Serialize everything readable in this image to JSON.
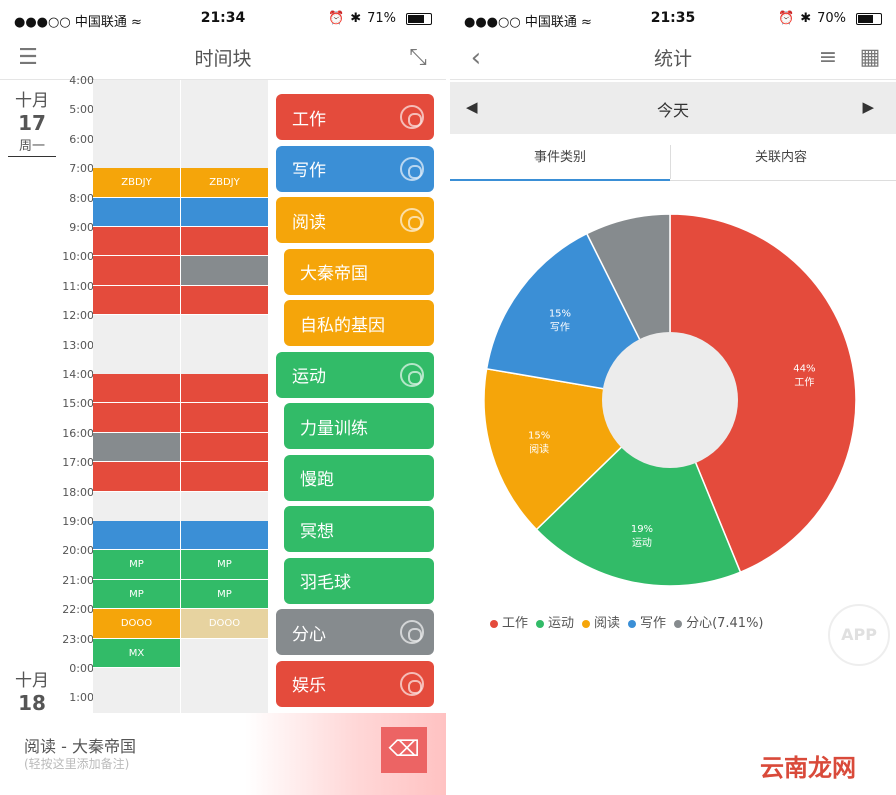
{
  "left": {
    "status": {
      "carrier": "●●●○○ 中国联通 ≈",
      "time": "21:34",
      "battery": "71%",
      "battery_pct": 71
    },
    "title": "时间块",
    "dates": [
      {
        "month": "十月",
        "day": "17",
        "weekday": "周一"
      },
      {
        "month": "十月",
        "day": "18"
      }
    ],
    "hours": [
      "4:00",
      "5:00",
      "6:00",
      "7:00",
      "8:00",
      "9:00",
      "10:00",
      "11:00",
      "12:00",
      "13:00",
      "14:00",
      "15:00",
      "16:00",
      "17:00",
      "18:00",
      "19:00",
      "20:00",
      "21:00",
      "22:00",
      "23:00",
      "0:00",
      "1:00"
    ],
    "blocks": [
      {
        "col": 0,
        "start": 7,
        "end": 8,
        "color": "#f5a50a",
        "label": "ZBDJY"
      },
      {
        "col": 1,
        "start": 7,
        "end": 8,
        "color": "#f5a50a",
        "label": "ZBDJY"
      },
      {
        "col": 0,
        "start": 8,
        "end": 9,
        "color": "#3b8fd6",
        "label": ""
      },
      {
        "col": 1,
        "start": 8,
        "end": 9,
        "color": "#3b8fd6",
        "label": ""
      },
      {
        "col": 0,
        "start": 9,
        "end": 10,
        "color": "#e44b3c",
        "label": ""
      },
      {
        "col": 1,
        "start": 9,
        "end": 10,
        "color": "#e44b3c",
        "label": ""
      },
      {
        "col": 0,
        "start": 10,
        "end": 11,
        "color": "#e44b3c",
        "label": ""
      },
      {
        "col": 1,
        "start": 10,
        "end": 11,
        "color": "#868b8e",
        "label": ""
      },
      {
        "col": 0,
        "start": 11,
        "end": 12,
        "color": "#e44b3c",
        "label": ""
      },
      {
        "col": 1,
        "start": 11,
        "end": 12,
        "color": "#e44b3c",
        "label": ""
      },
      {
        "col": 0,
        "start": 14,
        "end": 15,
        "color": "#e44b3c",
        "label": ""
      },
      {
        "col": 1,
        "start": 14,
        "end": 15,
        "color": "#e44b3c",
        "label": ""
      },
      {
        "col": 0,
        "start": 15,
        "end": 16,
        "color": "#e44b3c",
        "label": ""
      },
      {
        "col": 1,
        "start": 15,
        "end": 16,
        "color": "#e44b3c",
        "label": ""
      },
      {
        "col": 0,
        "start": 16,
        "end": 17,
        "color": "#868b8e",
        "label": ""
      },
      {
        "col": 1,
        "start": 16,
        "end": 17,
        "color": "#e44b3c",
        "label": ""
      },
      {
        "col": 0,
        "start": 17,
        "end": 18,
        "color": "#e44b3c",
        "label": ""
      },
      {
        "col": 1,
        "start": 17,
        "end": 18,
        "color": "#e44b3c",
        "label": ""
      },
      {
        "col": 0,
        "start": 19,
        "end": 20,
        "color": "#3b8fd6",
        "label": ""
      },
      {
        "col": 1,
        "start": 19,
        "end": 20,
        "color": "#3b8fd6",
        "label": ""
      },
      {
        "col": 0,
        "start": 20,
        "end": 21,
        "color": "#32bb68",
        "label": "MP"
      },
      {
        "col": 1,
        "start": 20,
        "end": 21,
        "color": "#32bb68",
        "label": "MP"
      },
      {
        "col": 0,
        "start": 21,
        "end": 22,
        "color": "#32bb68",
        "label": "MP"
      },
      {
        "col": 1,
        "start": 21,
        "end": 22,
        "color": "#32bb68",
        "label": "MP"
      },
      {
        "col": 0,
        "start": 22,
        "end": 23,
        "color": "#f5a50a",
        "label": "DOOO"
      },
      {
        "col": 1,
        "start": 22,
        "end": 23,
        "color": "#e7d3a0",
        "label": "DOOO"
      },
      {
        "col": 0,
        "start": 23,
        "end": 24,
        "color": "#32bb68",
        "label": "MX"
      }
    ],
    "categories": [
      {
        "label": "工作",
        "color": "#e44b3c",
        "link": true,
        "indent": false
      },
      {
        "label": "写作",
        "color": "#3b8fd6",
        "link": true,
        "indent": false
      },
      {
        "label": "阅读",
        "color": "#f5a50a",
        "link": true,
        "indent": false
      },
      {
        "label": "大秦帝国",
        "color": "#f5a50a",
        "link": false,
        "indent": true
      },
      {
        "label": "自私的基因",
        "color": "#f5a50a",
        "link": false,
        "indent": true
      },
      {
        "label": "运动",
        "color": "#32bb68",
        "link": true,
        "indent": false
      },
      {
        "label": "力量训练",
        "color": "#32bb68",
        "link": false,
        "indent": true
      },
      {
        "label": "慢跑",
        "color": "#32bb68",
        "link": false,
        "indent": true
      },
      {
        "label": "冥想",
        "color": "#32bb68",
        "link": false,
        "indent": true
      },
      {
        "label": "羽毛球",
        "color": "#32bb68",
        "link": false,
        "indent": true
      },
      {
        "label": "分心",
        "color": "#868b8e",
        "link": true,
        "indent": false
      },
      {
        "label": "娱乐",
        "color": "#e44b3c",
        "link": true,
        "indent": false
      }
    ],
    "bottom": {
      "title": "阅读 - 大秦帝国",
      "hint": "(轻按这里添加备注)"
    }
  },
  "right": {
    "status": {
      "carrier": "●●●○○ 中国联通 ≈",
      "time": "21:35",
      "battery": "70%",
      "battery_pct": 70
    },
    "title": "统计",
    "date_label": "今天",
    "tabs": [
      "事件类别",
      "关联内容"
    ],
    "legend": [
      {
        "label": "工作",
        "color": "#e44b3c"
      },
      {
        "label": "运动",
        "color": "#32bb68"
      },
      {
        "label": "阅读",
        "color": "#f5a50a"
      },
      {
        "label": "写作",
        "color": "#3b8fd6"
      },
      {
        "label": "分心(7.41%)",
        "color": "#868b8e"
      }
    ],
    "watermark": "APP",
    "brand": "云南龙网"
  },
  "chart_data": {
    "type": "pie",
    "donut": true,
    "slices": [
      {
        "name": "工作",
        "value": 44,
        "label": "44%",
        "color": "#e44b3c"
      },
      {
        "name": "运动",
        "value": 19,
        "label": "19%",
        "color": "#32bb68"
      },
      {
        "name": "阅读",
        "value": 15,
        "label": "15%",
        "color": "#f5a50a"
      },
      {
        "name": "写作",
        "value": 15,
        "label": "15%",
        "color": "#3b8fd6"
      },
      {
        "name": "分心",
        "value": 7.41,
        "label": "",
        "color": "#868b8e"
      }
    ]
  }
}
